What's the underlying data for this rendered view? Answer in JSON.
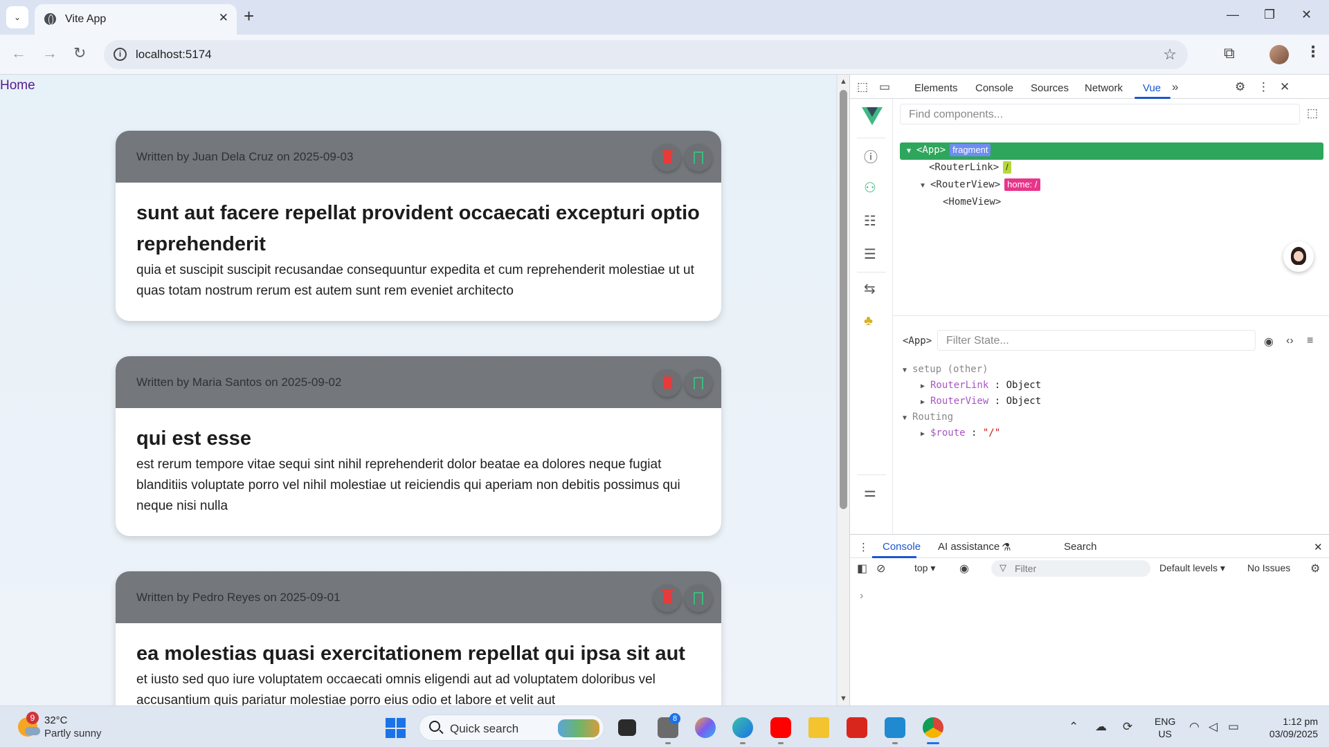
{
  "browser": {
    "tab_title": "Vite App",
    "url": "localhost:5174"
  },
  "page": {
    "home_link": "Home",
    "posts": [
      {
        "meta": "Written by Juan Dela Cruz on 2025-09-03",
        "title": "sunt aut facere repellat provident occaecati excepturi optio reprehenderit",
        "body": "quia et suscipit suscipit recusandae consequuntur expedita et cum reprehenderit molestiae ut ut quas totam nostrum rerum est autem sunt rem eveniet architecto"
      },
      {
        "meta": "Written by Maria Santos on 2025-09-02",
        "title": "qui est esse",
        "body": "est rerum tempore vitae sequi sint nihil reprehenderit dolor beatae ea dolores neque fugiat blanditiis voluptate porro vel nihil molestiae ut reiciendis qui aperiam non debitis possimus qui neque nisi nulla"
      },
      {
        "meta": "Written by Pedro Reyes on 2025-09-01",
        "title": "ea molestias quasi exercitationem repellat qui ipsa sit aut",
        "body": "et iusto sed quo iure voluptatem occaecati omnis eligendi aut ad voluptatem doloribus vel accusantium quis pariatur molestiae porro eius odio et labore et velit aut"
      }
    ]
  },
  "devtools": {
    "tabs": [
      "Elements",
      "Console",
      "Sources",
      "Network",
      "Vue"
    ],
    "active_tab": "Vue",
    "find_placeholder": "Find components...",
    "tree": [
      {
        "tag": "<App>",
        "badge": "fragment"
      },
      {
        "tag": "<RouterLink>",
        "badge": "/"
      },
      {
        "tag": "<RouterView>",
        "badge": "home: /"
      },
      {
        "tag": "<HomeView>"
      }
    ],
    "state_component": "<App>",
    "state_filter_placeholder": "Filter State...",
    "state": {
      "setup_label": "setup (other)",
      "routerlink_key": "RouterLink",
      "routerview_key": "RouterView",
      "object_value": "Object",
      "routing_label": "Routing",
      "route_key": "$route",
      "route_value": "\"/\""
    },
    "drawer": {
      "tabs": [
        "Console",
        "AI assistance",
        "Search"
      ],
      "context": "top",
      "filter_placeholder": "Filter",
      "levels": "Default levels",
      "issues": "No Issues",
      "prompt": "›"
    }
  },
  "taskbar": {
    "weather_temp": "32°C",
    "weather_desc": "Partly sunny",
    "weather_badge": "9",
    "search_placeholder": "Quick search",
    "app_badge": "8",
    "lang_line1": "ENG",
    "lang_line2": "US",
    "time": "1:12 pm",
    "date": "03/09/2025"
  },
  "colors": {
    "vue_green": "#41b883",
    "card_header": "#74777b",
    "delete_red": "#e83a3a",
    "bookmark_green": "#3dbb7d",
    "devtools_accent": "#1a56d0"
  }
}
